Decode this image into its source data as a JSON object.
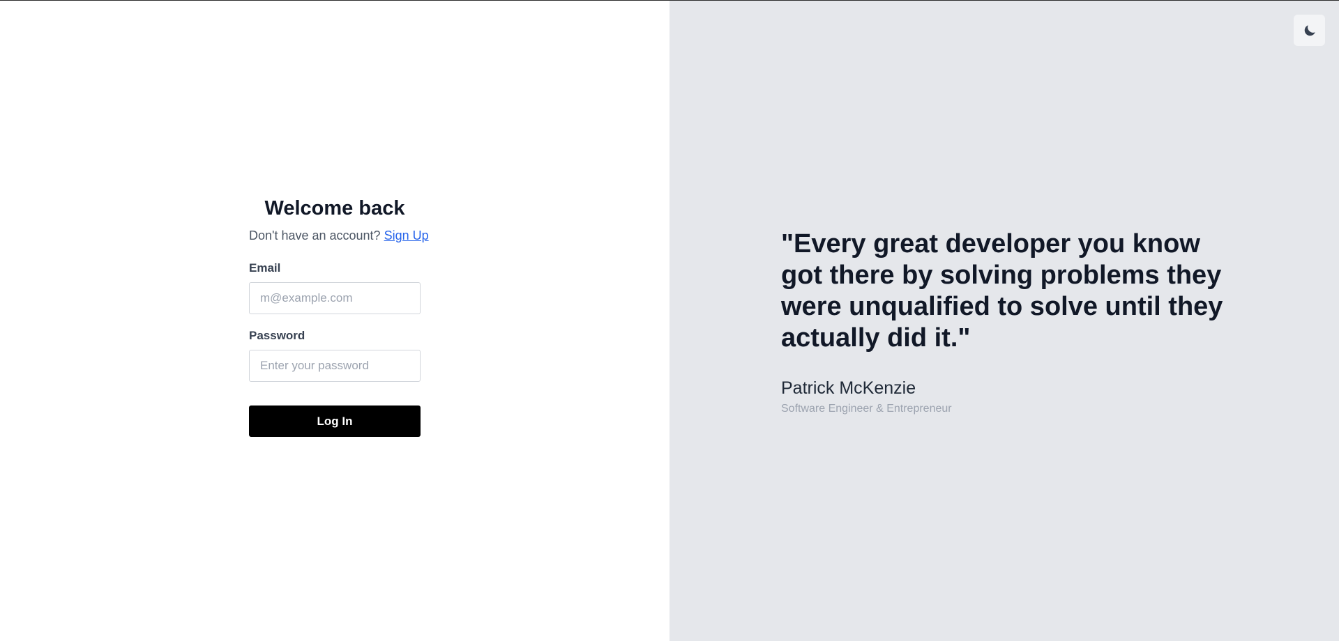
{
  "login": {
    "title": "Welcome back",
    "prompt": "Don't have an account? ",
    "signup_link": "Sign Up",
    "email": {
      "label": "Email",
      "placeholder": "m@example.com",
      "value": ""
    },
    "password": {
      "label": "Password",
      "placeholder": "Enter your password",
      "value": ""
    },
    "submit_label": "Log In"
  },
  "testimonial": {
    "quote": "\"Every great developer you know got there by solving problems they were unqualified to solve until they actually did it.\"",
    "author": "Patrick McKenzie",
    "role": "Software Engineer & Entrepreneur"
  },
  "theme_toggle": {
    "icon": "moon-icon"
  },
  "colors": {
    "left_background": "#ffffff",
    "right_background": "#e5e7eb",
    "button_background": "#000000",
    "link": "#2563eb",
    "heading": "#111827"
  }
}
